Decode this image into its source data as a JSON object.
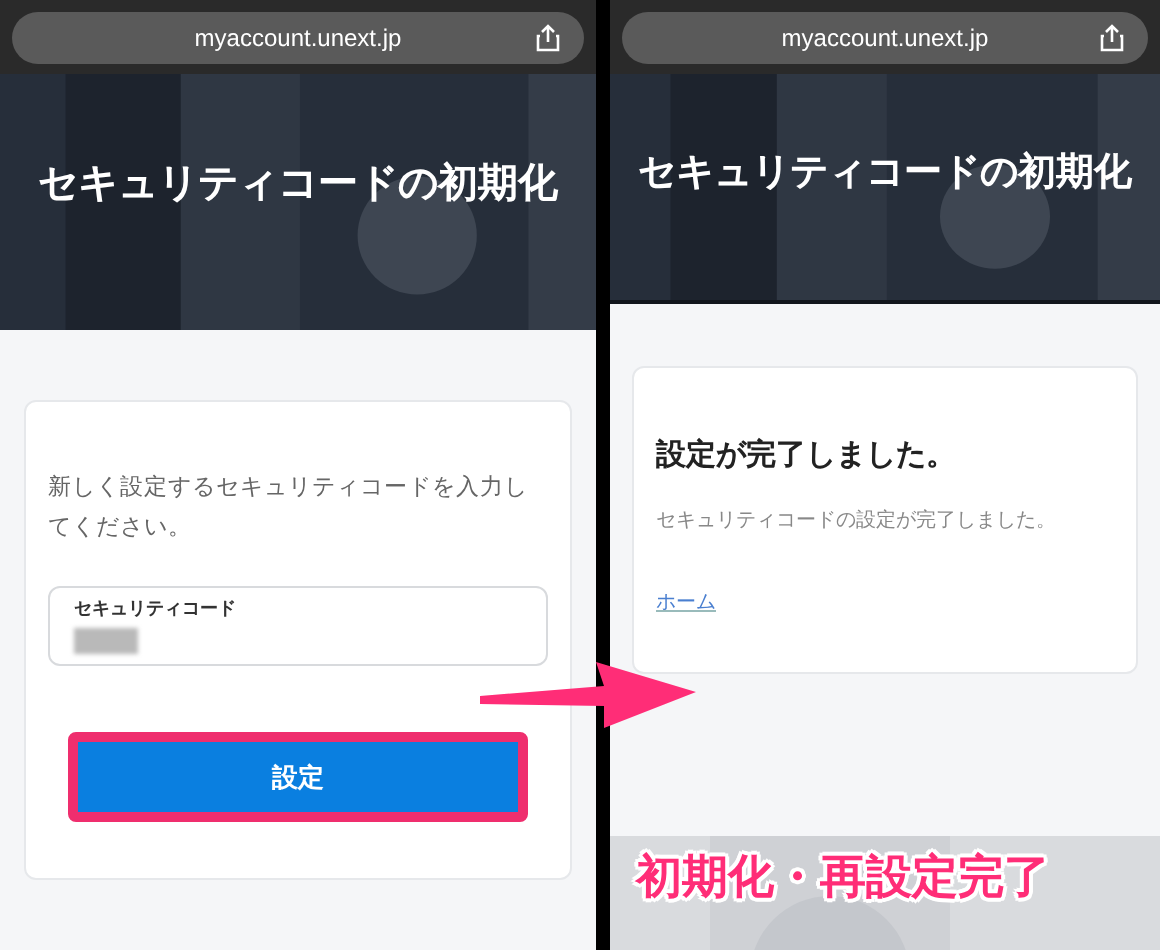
{
  "screens": [
    {
      "kind": "form",
      "url": "myaccount.unext.jp",
      "title": "セキュリティコードの初期化",
      "instruction": "新しく設定するセキュリティコードを入力してください。",
      "field": {
        "label": "セキュリティコード"
      },
      "button": {
        "label": "設定",
        "highlighted": true
      }
    },
    {
      "kind": "complete",
      "url": "myaccount.unext.jp",
      "title": "セキュリティコードの初期化",
      "heading": "設定が完了しました。",
      "message": "セキュリティコードの設定が完了しました。",
      "link": "ホーム"
    }
  ],
  "caption": "初期化・再設定完了"
}
